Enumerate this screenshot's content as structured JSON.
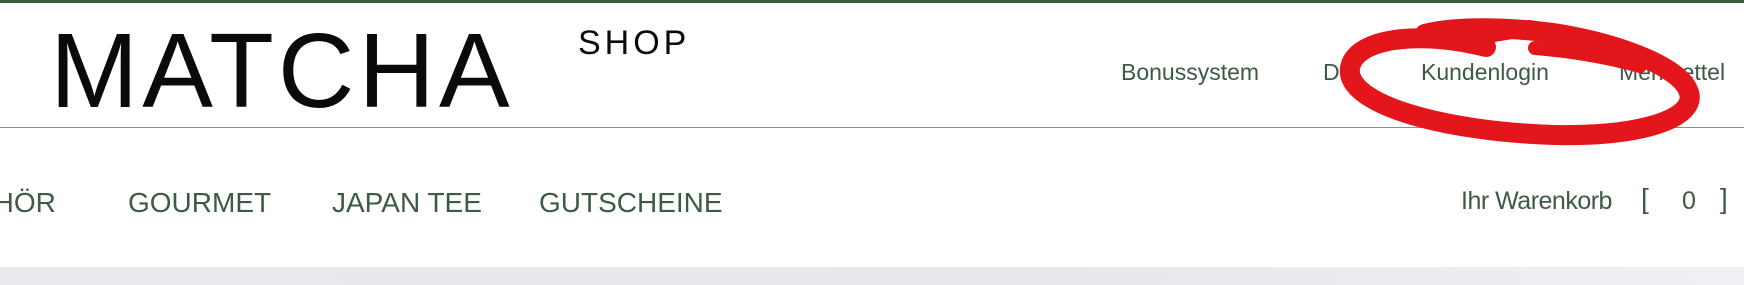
{
  "brand": {
    "logo_main": "MATCHA",
    "logo_sub": "SHOP"
  },
  "utility_nav": {
    "items": [
      {
        "label": "Bonussystem"
      },
      {
        "label": "DE"
      },
      {
        "label": "Kundenlogin"
      },
      {
        "label": "Merkzettel"
      }
    ]
  },
  "main_nav": {
    "items": [
      {
        "label": "ZUBEHÖR"
      },
      {
        "label": "GOURMET"
      },
      {
        "label": "JAPAN TEE"
      },
      {
        "label": "GUTSCHEINE"
      }
    ]
  },
  "cart": {
    "label": "Ihr Warenkorb",
    "open_bracket": "[",
    "count": "0",
    "close_bracket": "]"
  },
  "colors": {
    "accent_green": "#3d5a45",
    "logo_black": "#0a0a0a",
    "annotation_red": "#e3161b"
  }
}
